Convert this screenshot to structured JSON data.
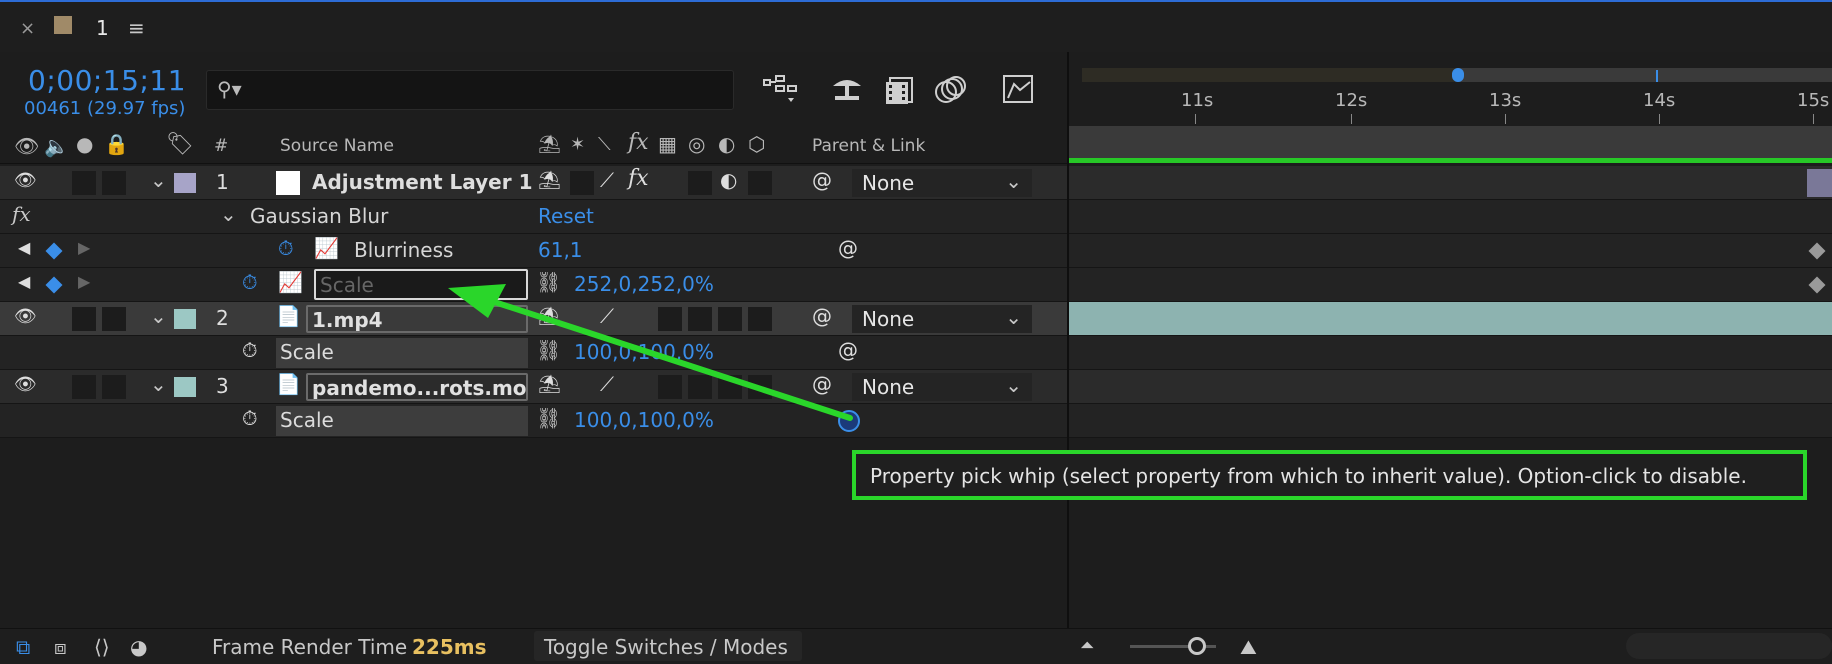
{
  "tab": {
    "close": "×",
    "label": "1",
    "menu": "≡",
    "swatch_color": "#a08a68"
  },
  "header": {
    "timecode": "0;00;15;11",
    "frames": "00461 (29.97 fps)",
    "search_placeholder": ""
  },
  "columns": {
    "hash": "#",
    "source_name": "Source Name",
    "parent_link": "Parent & Link",
    "fx": "fx"
  },
  "layers": [
    {
      "index": "1",
      "name": "Adjustment Layer 1",
      "label_color": "#a7a4c8",
      "parent": "None"
    },
    {
      "index": "2",
      "name": "1.mp4",
      "label_color": "#9cc8c4",
      "parent": "None"
    },
    {
      "index": "3",
      "name": "pandemo...rots.mov",
      "label_color": "#9cc8c4",
      "parent": "None"
    }
  ],
  "effects": {
    "fx_label": "fx",
    "gaussian_blur": "Gaussian Blur",
    "reset": "Reset",
    "blurriness_label": "Blurriness",
    "blurriness_value": "61,1",
    "scale_label": "Scale",
    "scale_value": "252,0,252,0%"
  },
  "props": {
    "layer2_scale_label": "Scale",
    "layer2_scale_value": "100,0,100,0%",
    "layer3_scale_label": "Scale",
    "layer3_scale_value": "100,0,100,0%"
  },
  "ruler": [
    "11s",
    "12s",
    "13s",
    "14s",
    "15s"
  ],
  "tooltip": "Property pick whip (select property from which to inherit value). Option-click to disable.",
  "footer": {
    "frame_render_label": "Frame Render Time",
    "frame_render_value": "225ms",
    "toggle": "Toggle Switches / Modes"
  },
  "colors": {
    "accent_blue": "#3a8ee8",
    "highlight_green": "#2ad62a",
    "render_time": "#e8c060"
  }
}
